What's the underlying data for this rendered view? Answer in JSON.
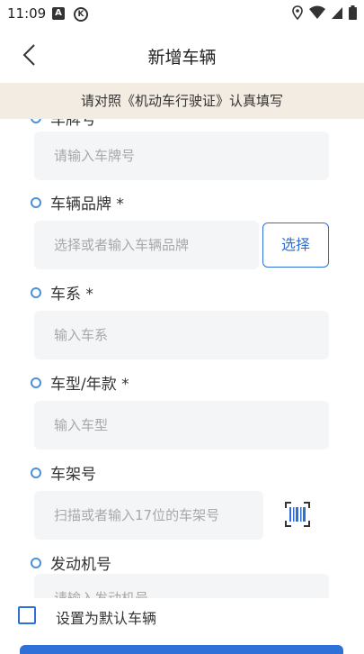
{
  "status_bar": {
    "time": "11:09",
    "left_icons": [
      "notification-a-icon",
      "k-app-icon"
    ],
    "right_icons": [
      "location-icon",
      "wifi-icon",
      "signal-icon",
      "battery-icon"
    ]
  },
  "nav": {
    "title": "新增车辆",
    "back_icon": "chevron-left-icon"
  },
  "notice": {
    "text": "请对照《机动车行驶证》认真填写"
  },
  "form": {
    "cut_off_label": "车牌号",
    "plate": {
      "placeholder": "请输入车牌号"
    },
    "brand": {
      "label": "车辆品牌 *",
      "placeholder": "选择或者输入车辆品牌",
      "select_label": "选择"
    },
    "series": {
      "label": "车系 *",
      "placeholder": "输入车系"
    },
    "model": {
      "label": "车型/年款 *",
      "placeholder": "输入车型"
    },
    "vin": {
      "label": "车架号",
      "placeholder": "扫描或者输入17位的车架号",
      "scan_icon": "barcode-scan-icon"
    },
    "engine": {
      "label": "发动机号",
      "placeholder": "请输入发动机号"
    }
  },
  "bottom": {
    "default_label": "设置为默认车辆",
    "checked": false
  },
  "colors": {
    "accent": "#2f6fd8",
    "notice_bg": "#f3ece3",
    "input_bg": "#f4f5f7"
  }
}
